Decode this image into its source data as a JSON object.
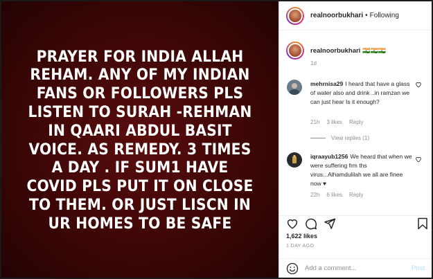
{
  "post": {
    "image_text": "PRAYER FOR INDIA ALLAH REHAM. ANY OF MY INDIAN FANS OR FOLLOWERS PLS LISTEN TO SURAH -REHMAN IN QAARI ABDUL BASIT VOICE. AS REMEDY.  3 TIMES A DAY . IF SUM1 HAVE COVID PLS PUT IT ON CLOSE TO THEM. OR JUST LISCN IN UR HOMES TO BE SAFE",
    "image_background": "#3d0606"
  },
  "header": {
    "username": "realnoorbukhari",
    "separator": "•",
    "following_label": "Following"
  },
  "caption": {
    "username": "realnoorbukhari",
    "emoji_text": "🇮🇳🇮🇳🇮🇳",
    "time": "1d"
  },
  "comments": [
    {
      "username": "mehrnisa29",
      "text": "I heard that have a glass of water also and drink ..in ramzan we can just hear Is it enough?",
      "time": "21h",
      "likes": "3 likes",
      "reply_label": "Reply",
      "view_replies": "View replies (1)"
    },
    {
      "username": "iqraayub1256",
      "text": "We heard that when we were suffering frm ths virus...Alhamdulilah we all are finee now ♥",
      "time": "22h",
      "likes": "6 likes",
      "reply_label": "Reply"
    }
  ],
  "actions": {
    "like_icon": "heart-icon",
    "comment_icon": "comment-icon",
    "share_icon": "share-icon",
    "save_icon": "bookmark-icon"
  },
  "likes_count": "1,622 likes",
  "post_date": "1 DAY AGO",
  "add_comment": {
    "placeholder": "Add a comment...",
    "post_label": "Post"
  },
  "colors": {
    "link_blue": "#b2dffc",
    "muted": "#8e8e8e",
    "text": "#262626"
  }
}
